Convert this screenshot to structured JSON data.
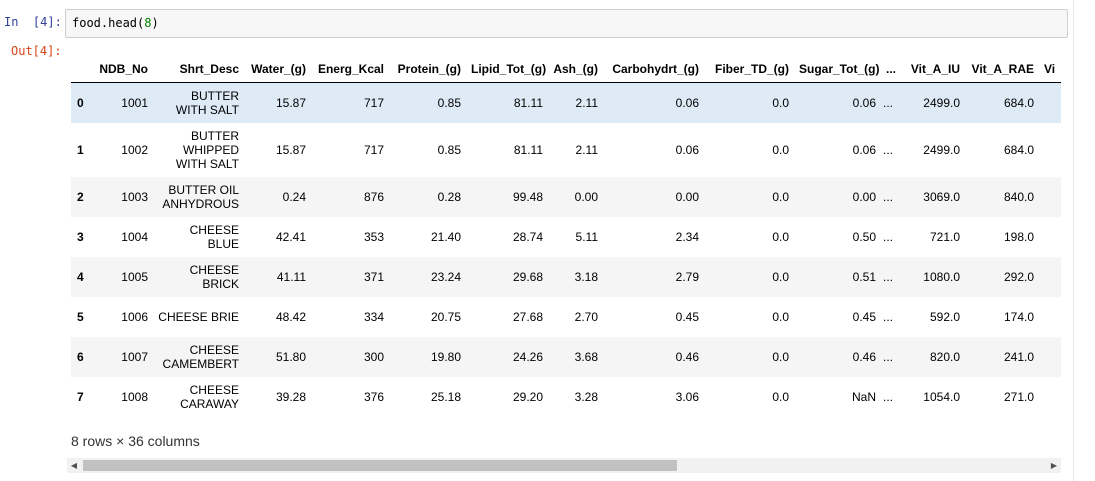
{
  "input_cell": {
    "prompt": "In  [4]:",
    "code_prefix": "food.head(",
    "code_arg": "8",
    "code_suffix": ")"
  },
  "output_cell": {
    "prompt": "Out[4]:"
  },
  "table": {
    "columns": [
      "",
      "NDB_No",
      "Shrt_Desc",
      "Water_(g)",
      "Energ_Kcal",
      "Protein_(g)",
      "Lipid_Tot_(g)",
      "Ash_(g)",
      "Carbohydrt_(g)",
      "Fiber_TD_(g)",
      "Sugar_Tot_(g)",
      "...",
      "Vit_A_IU",
      "Vit_A_RAE",
      "Vi"
    ],
    "rows": [
      {
        "index": "0",
        "cells": [
          "1001",
          "BUTTER WITH SALT",
          "15.87",
          "717",
          "0.85",
          "81.11",
          "2.11",
          "0.06",
          "0.0",
          "0.06",
          "...",
          "2499.0",
          "684.0",
          ""
        ]
      },
      {
        "index": "1",
        "cells": [
          "1002",
          "BUTTER WHIPPED WITH SALT",
          "15.87",
          "717",
          "0.85",
          "81.11",
          "2.11",
          "0.06",
          "0.0",
          "0.06",
          "...",
          "2499.0",
          "684.0",
          ""
        ]
      },
      {
        "index": "2",
        "cells": [
          "1003",
          "BUTTER OIL ANHYDROUS",
          "0.24",
          "876",
          "0.28",
          "99.48",
          "0.00",
          "0.00",
          "0.0",
          "0.00",
          "...",
          "3069.0",
          "840.0",
          ""
        ]
      },
      {
        "index": "3",
        "cells": [
          "1004",
          "CHEESE BLUE",
          "42.41",
          "353",
          "21.40",
          "28.74",
          "5.11",
          "2.34",
          "0.0",
          "0.50",
          "...",
          "721.0",
          "198.0",
          ""
        ]
      },
      {
        "index": "4",
        "cells": [
          "1005",
          "CHEESE BRICK",
          "41.11",
          "371",
          "23.24",
          "29.68",
          "3.18",
          "2.79",
          "0.0",
          "0.51",
          "...",
          "1080.0",
          "292.0",
          ""
        ]
      },
      {
        "index": "5",
        "cells": [
          "1006",
          "CHEESE BRIE",
          "48.42",
          "334",
          "20.75",
          "27.68",
          "2.70",
          "0.45",
          "0.0",
          "0.45",
          "...",
          "592.0",
          "174.0",
          ""
        ]
      },
      {
        "index": "6",
        "cells": [
          "1007",
          "CHEESE CAMEMBERT",
          "51.80",
          "300",
          "19.80",
          "24.26",
          "3.68",
          "0.46",
          "0.0",
          "0.46",
          "...",
          "820.0",
          "241.0",
          ""
        ]
      },
      {
        "index": "7",
        "cells": [
          "1008",
          "CHEESE CARAWAY",
          "39.28",
          "376",
          "25.18",
          "29.20",
          "3.28",
          "3.06",
          "0.0",
          "NaN",
          "...",
          "1054.0",
          "271.0",
          ""
        ]
      }
    ],
    "summary": "8 rows × 36 columns"
  },
  "scrollbar": {
    "left_arrow": "◀",
    "right_arrow": "▶",
    "thumb_fraction": 0.6
  },
  "colors": {
    "in_prompt": "#303f9f",
    "out_prompt": "#d84315",
    "hover_row": "#deebf7",
    "stripe_row": "#f5f5f5"
  }
}
